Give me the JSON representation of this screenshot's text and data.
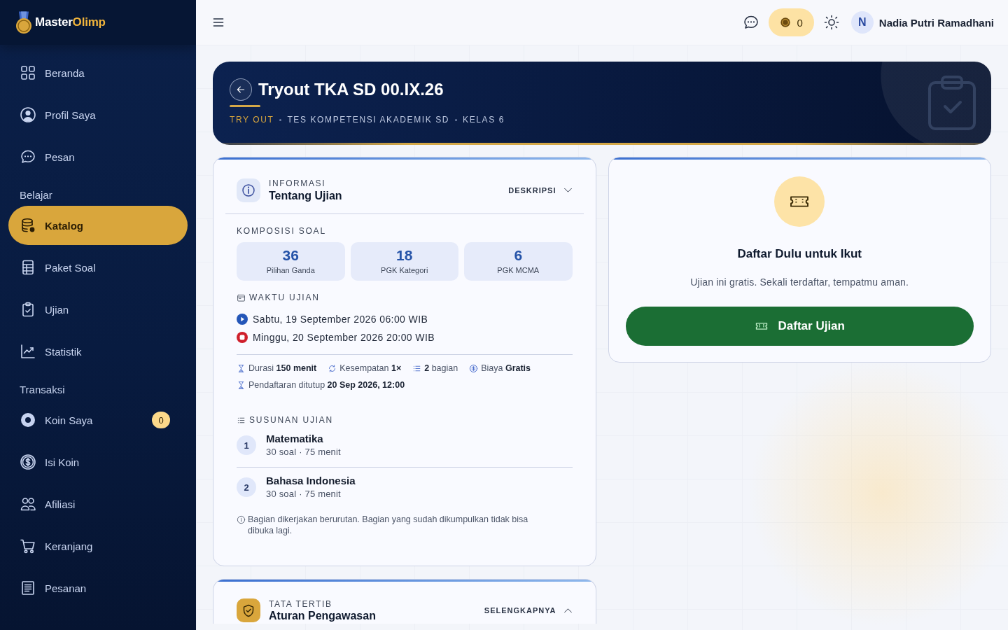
{
  "brand": {
    "name": "Master",
    "accent": "Olimp"
  },
  "sidebar": {
    "sections": [
      {
        "items": [
          {
            "label": "Beranda",
            "selected": false
          },
          {
            "label": "Profil Saya",
            "selected": false
          },
          {
            "label": "Pesan",
            "selected": false
          }
        ]
      },
      {
        "heading": "Belajar",
        "items": [
          {
            "label": "Katalog",
            "selected": true
          },
          {
            "label": "Paket Soal",
            "selected": false
          },
          {
            "label": "Ujian",
            "selected": false
          },
          {
            "label": "Statistik",
            "selected": false
          }
        ]
      },
      {
        "heading": "Transaksi",
        "items": [
          {
            "label": "Koin Saya",
            "selected": false,
            "badge": "0"
          },
          {
            "label": "Isi Koin",
            "selected": false
          },
          {
            "label": "Afiliasi",
            "selected": false
          },
          {
            "label": "Keranjang",
            "selected": false
          },
          {
            "label": "Pesanan",
            "selected": false
          }
        ]
      }
    ]
  },
  "topbar": {
    "coins": "0",
    "avatar_initial": "N",
    "user_name": "Nadia Putri Ramadhani"
  },
  "banner": {
    "title": "Tryout TKA SD 00.IX.26",
    "tags": [
      {
        "text": "TRY OUT",
        "highlight": true
      },
      {
        "text": "TES KOMPETENSI AKADEMIK SD",
        "highlight": false
      },
      {
        "text": "KELAS 6",
        "highlight": false
      }
    ]
  },
  "info_card": {
    "eyebrow": "INFORMASI",
    "title": "Tentang Ujian",
    "toggle": {
      "label": "DESKRIPSI",
      "expanded": false
    },
    "composition": {
      "heading": "KOMPOSISI SOAL",
      "items": [
        {
          "count": "36",
          "label": "Pilihan Ganda"
        },
        {
          "count": "18",
          "label": "PGK Kategori"
        },
        {
          "count": "6",
          "label": "PGK MCMA"
        }
      ]
    },
    "schedule": {
      "heading": "WAKTU UJIAN",
      "entries": [
        {
          "kind": "start",
          "text": "Sabtu, 19 September 2026 06:00 WIB"
        },
        {
          "kind": "end",
          "text": "Minggu, 20 September 2026 20:00 WIB"
        }
      ]
    },
    "fact_rows": [
      {
        "items": [
          {
            "kind": "duration",
            "text": "Durasi **150 menit**"
          },
          {
            "kind": "attempts",
            "text": "Kesempatan **1×**"
          },
          {
            "kind": "sections",
            "text": "**2** bagian"
          },
          {
            "kind": "fee",
            "text": "Biaya **Gratis**"
          }
        ]
      },
      {
        "items": [
          {
            "kind": "deadline",
            "text": "Pendaftaran ditutup **20 Sep 2026, 12:00**"
          }
        ]
      }
    ],
    "structure": {
      "heading": "SUSUNAN UJIAN",
      "parts": [
        {
          "number": "1",
          "name": "Matematika",
          "detail": "30 soal · 75 menit"
        },
        {
          "number": "2",
          "name": "Bahasa Indonesia",
          "detail": "30 soal · 75 menit"
        }
      ],
      "note": "Bagian dikerjakan berurutan. Bagian yang sudah dikumpulkan tidak bisa dibuka lagi."
    }
  },
  "rules_card": {
    "eyebrow": "TATA TERTIB",
    "title": "Aturan Pengawasan",
    "toggle": {
      "label": "SELENGKAPNYA",
      "expanded": true
    }
  },
  "register_card": {
    "title": "Daftar Dulu untuk Ikut",
    "text": "Ujian ini gratis. Sekali terdaftar, tempatmu aman.",
    "button": "Daftar Ujian"
  }
}
